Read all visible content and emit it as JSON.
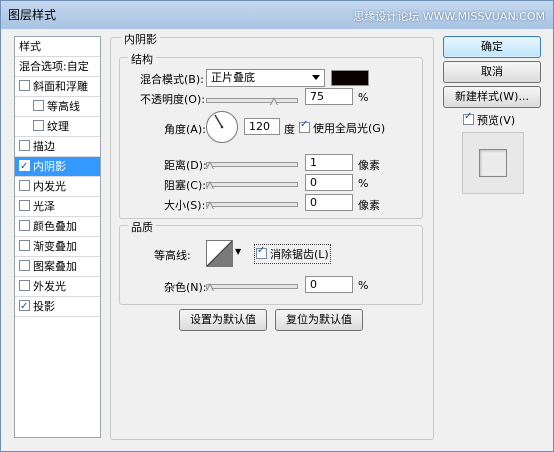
{
  "window": {
    "title": "图层样式",
    "watermark": "思缘设计论坛 WWW.MISSVUAN.COM"
  },
  "sidebar": {
    "header_styles": "样式",
    "header_blending": "混合选项:自定",
    "items": [
      {
        "label": "斜面和浮雕",
        "checked": false
      },
      {
        "label": "等高线",
        "checked": false
      },
      {
        "label": "纹理",
        "checked": false
      },
      {
        "label": "描边",
        "checked": false
      },
      {
        "label": "内阴影",
        "checked": true,
        "selected": true
      },
      {
        "label": "内发光",
        "checked": false
      },
      {
        "label": "光泽",
        "checked": false
      },
      {
        "label": "颜色叠加",
        "checked": false
      },
      {
        "label": "渐变叠加",
        "checked": false
      },
      {
        "label": "图案叠加",
        "checked": false
      },
      {
        "label": "外发光",
        "checked": false
      },
      {
        "label": "投影",
        "checked": true
      }
    ]
  },
  "inner_shadow": {
    "title": "内阴影",
    "structure": {
      "title": "结构",
      "blend_mode_label": "混合模式(B):",
      "blend_mode_value": "正片叠底",
      "blend_color": "#0a0000",
      "opacity_label": "不透明度(O):",
      "opacity_value": "75",
      "opacity_unit": "%",
      "opacity_level": 0.75,
      "angle_label": "角度(A):",
      "angle_value": "120",
      "angle_unit": "度",
      "use_global_light_label": "使用全局光(G)",
      "use_global_light_checked": true,
      "distance_label": "距离(D):",
      "distance_value": "1",
      "distance_unit": "像素",
      "choke_label": "阻塞(C):",
      "choke_value": "0",
      "choke_unit": "%",
      "size_label": "大小(S):",
      "size_value": "0",
      "size_unit": "像素"
    },
    "quality": {
      "title": "品质",
      "contour_label": "等高线:",
      "anti_aliased_label": "消除锯齿(L)",
      "anti_aliased_checked": true,
      "noise_label": "杂色(N):",
      "noise_value": "0",
      "noise_unit": "%"
    },
    "make_default_label": "设置为默认值",
    "reset_default_label": "复位为默认值"
  },
  "buttons": {
    "ok": "确定",
    "cancel": "取消",
    "new_style": "新建样式(W)...",
    "preview_label": "预览(V)",
    "preview_checked": true
  }
}
